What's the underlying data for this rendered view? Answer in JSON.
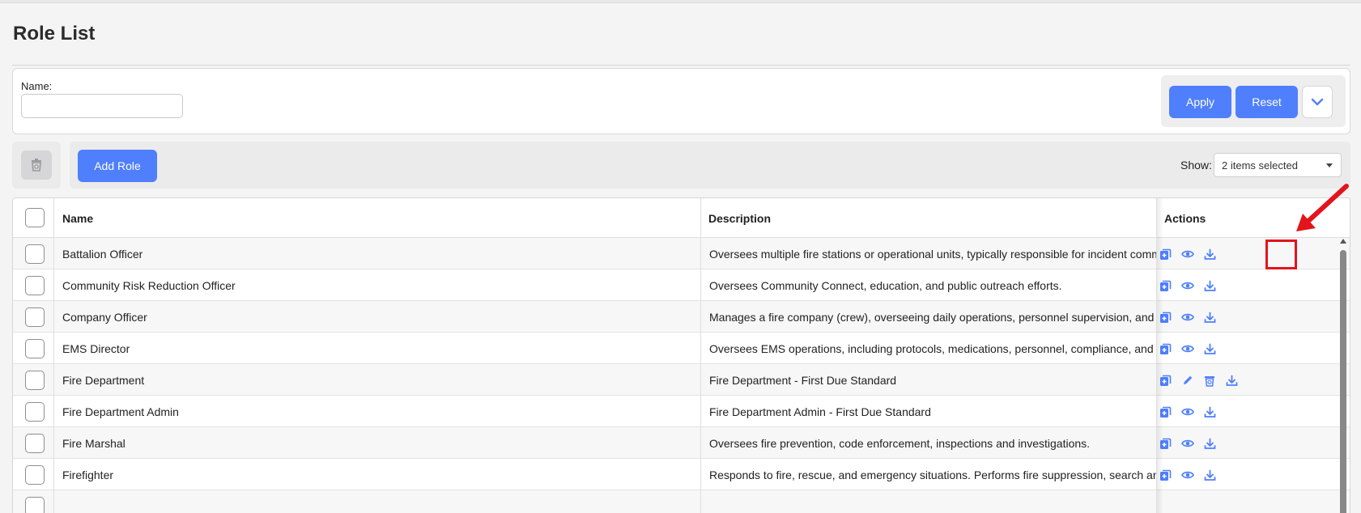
{
  "page": {
    "title": "Role List"
  },
  "filter": {
    "name_label": "Name:",
    "name_value": "",
    "apply_label": "Apply",
    "reset_label": "Reset"
  },
  "toolbar": {
    "add_role_label": "Add Role",
    "show_label": "Show:",
    "show_value": "2 items selected"
  },
  "table": {
    "headers": {
      "name": "Name",
      "description": "Description",
      "actions": "Actions"
    },
    "rows": [
      {
        "name": "Battalion Officer",
        "description": "Oversees multiple fire stations or operational units, typically responsible for incident command, sh",
        "actions": [
          "copy-icon",
          "eye-icon",
          "download-icon"
        ]
      },
      {
        "name": "Community Risk Reduction Officer",
        "description": "Oversees Community Connect, education, and public outreach efforts.",
        "actions": [
          "copy-icon",
          "eye-icon",
          "download-icon"
        ]
      },
      {
        "name": "Company Officer",
        "description": "Manages a fire company (crew), overseeing daily operations, personnel supervision, and response r",
        "actions": [
          "copy-icon",
          "eye-icon",
          "download-icon"
        ]
      },
      {
        "name": "EMS Director",
        "description": "Oversees EMS operations, including protocols, medications, personnel, compliance, and reporting.",
        "actions": [
          "copy-icon",
          "eye-icon",
          "download-icon"
        ]
      },
      {
        "name": "Fire Department",
        "description": "Fire Department - First Due Standard",
        "actions": [
          "copy-icon",
          "pencil-icon",
          "trash-icon",
          "download-icon"
        ]
      },
      {
        "name": "Fire Department Admin",
        "description": "Fire Department Admin - First Due Standard",
        "actions": [
          "copy-icon",
          "eye-icon",
          "download-icon"
        ]
      },
      {
        "name": "Fire Marshal",
        "description": "Oversees fire prevention, code enforcement, inspections and investigations.",
        "actions": [
          "copy-icon",
          "eye-icon",
          "download-icon"
        ]
      },
      {
        "name": "Firefighter",
        "description": "Responds to fire, rescue, and emergency situations. Performs fire suppression, search and rescue, a",
        "actions": [
          "copy-icon",
          "eye-icon",
          "download-icon"
        ]
      },
      {
        "name": "",
        "description": "",
        "actions": []
      }
    ]
  },
  "colors": {
    "accent": "#4f7ffc",
    "annotation": "#e3141c"
  }
}
